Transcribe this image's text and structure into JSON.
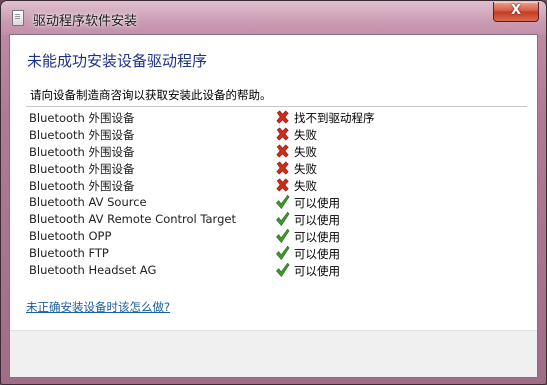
{
  "window": {
    "title": "驱动程序软件安装",
    "close_label": "X"
  },
  "content": {
    "main_title": "未能成功安装设备驱动程序",
    "instruction": "请向设备制造商咨询以获取安装此设备的帮助。",
    "help_link": "未正确安装设备时该怎么做?"
  },
  "devices": [
    {
      "name": "Bluetooth 外围设备",
      "status": "找不到驱动程序",
      "icon": "error-x-icon"
    },
    {
      "name": "Bluetooth 外围设备",
      "status": "失败",
      "icon": "error-x-icon"
    },
    {
      "name": "Bluetooth 外围设备",
      "status": "失败",
      "icon": "error-x-icon"
    },
    {
      "name": "Bluetooth 外围设备",
      "status": "失败",
      "icon": "error-x-icon"
    },
    {
      "name": "Bluetooth 外围设备",
      "status": "失败",
      "icon": "error-x-icon"
    },
    {
      "name": "Bluetooth AV Source",
      "status": "可以使用",
      "icon": "check-icon"
    },
    {
      "name": "Bluetooth AV Remote Control Target",
      "status": "可以使用",
      "icon": "check-icon"
    },
    {
      "name": "Bluetooth OPP",
      "status": "可以使用",
      "icon": "check-icon"
    },
    {
      "name": "Bluetooth FTP",
      "status": "可以使用",
      "icon": "check-icon"
    },
    {
      "name": "Bluetooth Headset AG",
      "status": "可以使用",
      "icon": "check-icon"
    }
  ],
  "colors": {
    "title_text": "#1e3287",
    "link": "#1a5ea3",
    "error": "#d42a1c",
    "success": "#3f9a2e"
  }
}
